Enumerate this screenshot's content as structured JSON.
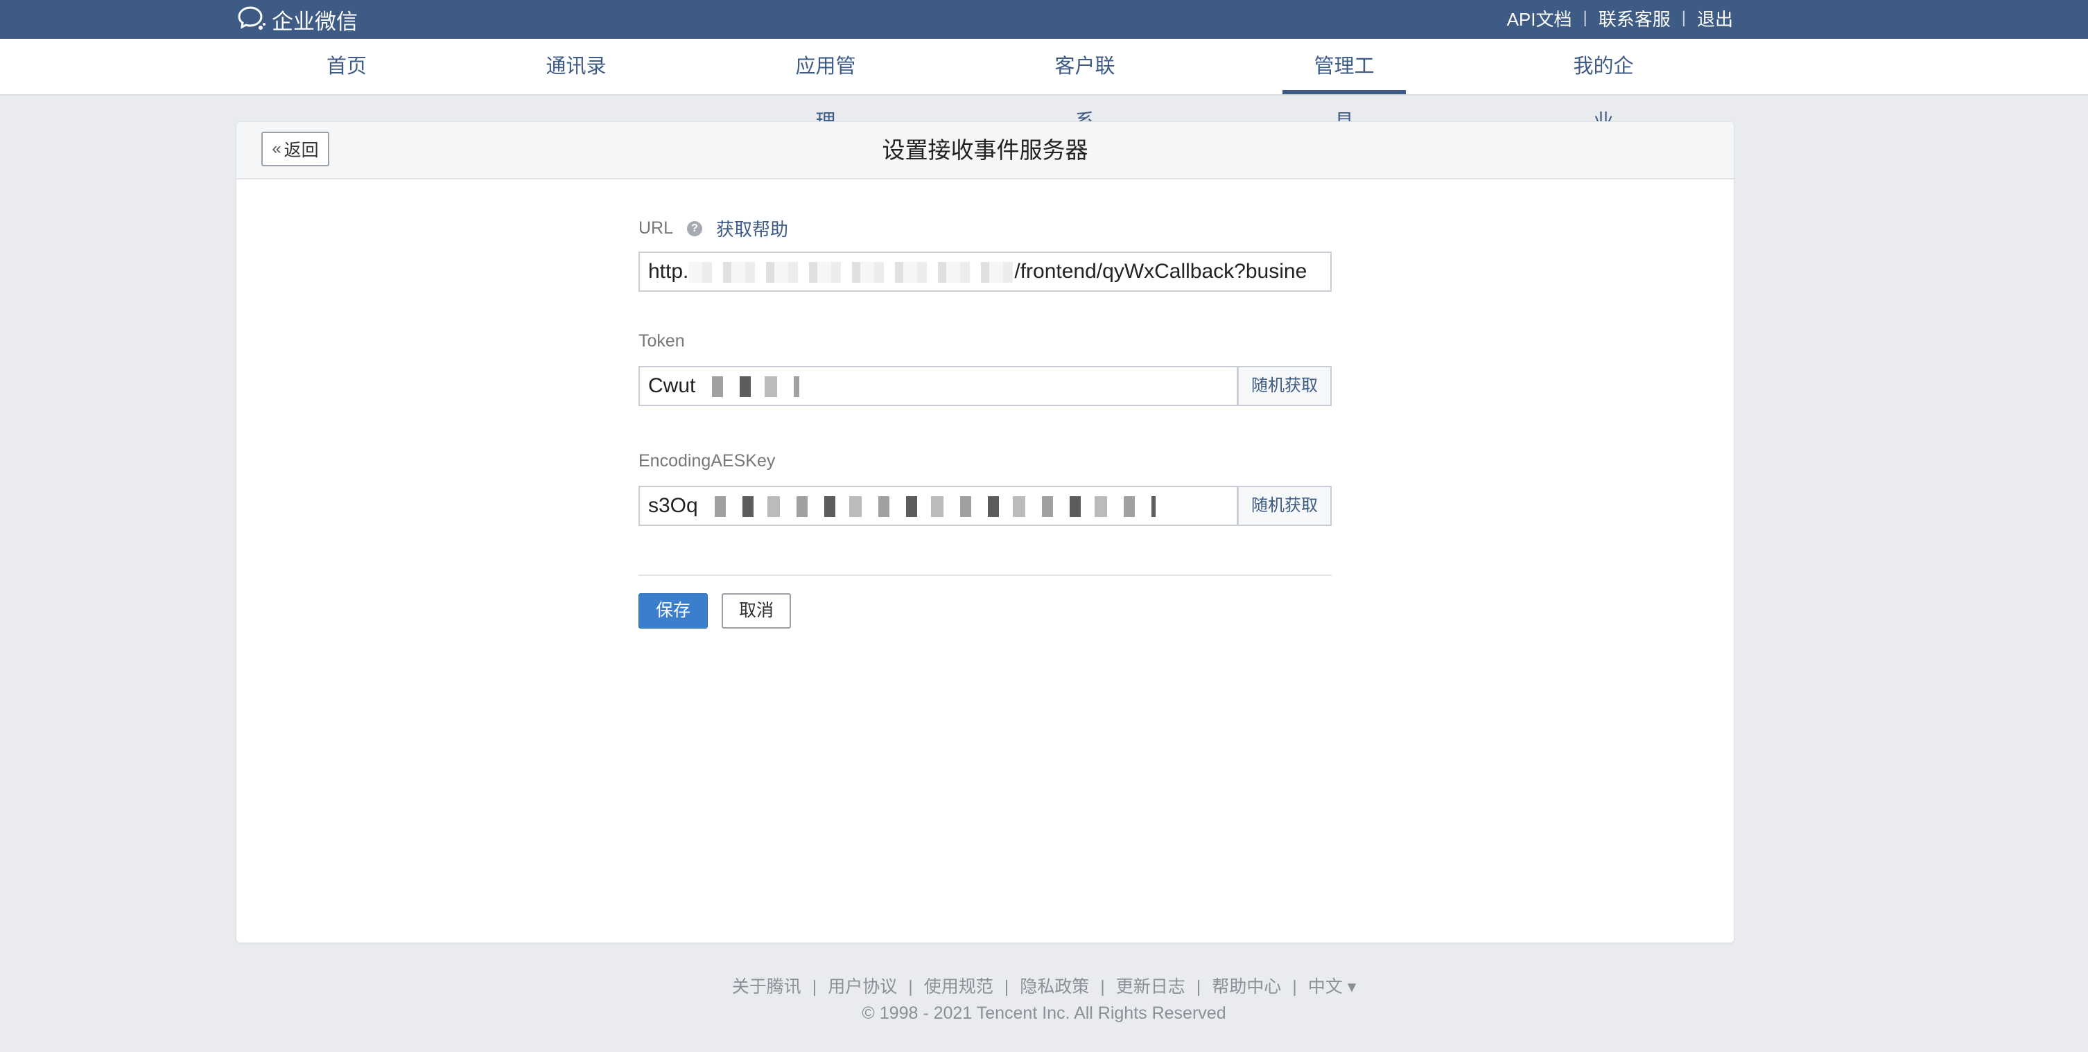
{
  "app": {
    "logo_text": "企业微信"
  },
  "top_links": [
    "API文档",
    "联系客服",
    "退出"
  ],
  "nav": {
    "items": [
      "首页",
      "通讯录",
      "应用管理",
      "客户联系",
      "管理工具",
      "我的企业"
    ],
    "active": "管理工具"
  },
  "page": {
    "back_label": "返回",
    "title": "设置接收事件服务器"
  },
  "form": {
    "url": {
      "label": "URL",
      "help_link": "获取帮助",
      "value_prefix": "http.",
      "value_suffix": "/frontend/qyWxCallback?busine"
    },
    "token": {
      "label": "Token",
      "value_prefix": "Cwut",
      "random_label": "随机获取"
    },
    "aes_key": {
      "label": "EncodingAESKey",
      "value_prefix": "s3Oq",
      "random_label": "随机获取"
    },
    "save_label": "保存",
    "cancel_label": "取消"
  },
  "footer": {
    "links": [
      "关于腾讯",
      "用户协议",
      "使用规范",
      "隐私政策",
      "更新日志",
      "帮助中心",
      "中文 ▾"
    ],
    "copyright": "© 1998 - 2021 Tencent Inc. All Rights Reserved"
  },
  "colors": {
    "topbar": "#3d5b85",
    "accent": "#3d5b85",
    "primary_button": "#3b7fcc",
    "background": "#e9ebee"
  }
}
